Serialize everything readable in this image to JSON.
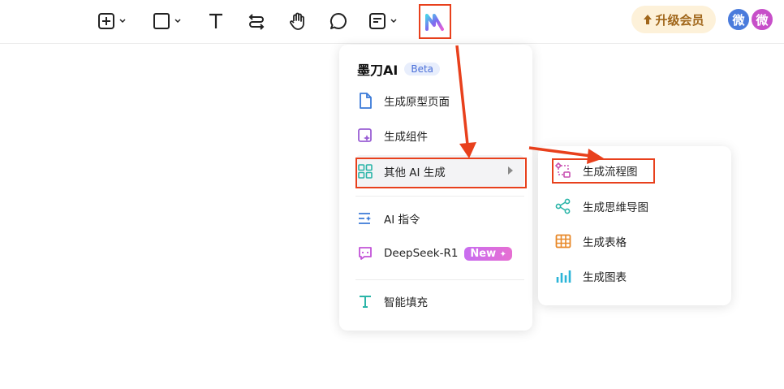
{
  "toolbar": {
    "tools": [
      {
        "icon": "add-frame-icon",
        "has_dropdown": true
      },
      {
        "icon": "rectangle-icon",
        "has_dropdown": true
      },
      {
        "icon": "text-icon",
        "has_dropdown": false
      },
      {
        "icon": "connector-icon",
        "has_dropdown": false
      },
      {
        "icon": "hand-icon",
        "has_dropdown": false
      },
      {
        "icon": "comment-icon",
        "has_dropdown": false
      },
      {
        "icon": "sticky-note-icon",
        "has_dropdown": true
      },
      {
        "icon": "motiff-ai-logo-icon",
        "has_dropdown": false
      }
    ],
    "upgrade_label": "升级会员",
    "avatars": [
      "微",
      "微"
    ]
  },
  "menu": {
    "title": "墨刀AI",
    "badge": "Beta",
    "items": [
      {
        "label": "生成原型页面",
        "icon": "page-icon",
        "color": "#3b7ad8"
      },
      {
        "label": "生成组件",
        "icon": "component-sparkle-icon",
        "color": "#9a5fd4"
      },
      {
        "label": "其他 AI 生成",
        "icon": "grid-icon",
        "color": "#2bb5a8"
      },
      {
        "label": "AI 指令",
        "icon": "ai-command-icon",
        "color": "#3b7ad8"
      },
      {
        "label": "DeepSeek-R1",
        "icon": "deepseek-icon",
        "color": "#c254d8",
        "badge": "New"
      },
      {
        "label": "智能填充",
        "icon": "text-fill-icon",
        "color": "#2bb5a8"
      }
    ]
  },
  "submenu": {
    "items": [
      {
        "label": "生成流程图",
        "icon": "flowchart-icon",
        "color": "#c84fb0"
      },
      {
        "label": "生成思维导图",
        "icon": "mindmap-icon",
        "color": "#2bb5a8"
      },
      {
        "label": "生成表格",
        "icon": "table-icon",
        "color": "#e8892a"
      },
      {
        "label": "生成图表",
        "icon": "bar-chart-icon",
        "color": "#2bb5d8"
      }
    ]
  },
  "colors": {
    "highlight": "#e8401c",
    "upgrade_bg": "#fdf1d9",
    "upgrade_text": "#a0661a"
  }
}
